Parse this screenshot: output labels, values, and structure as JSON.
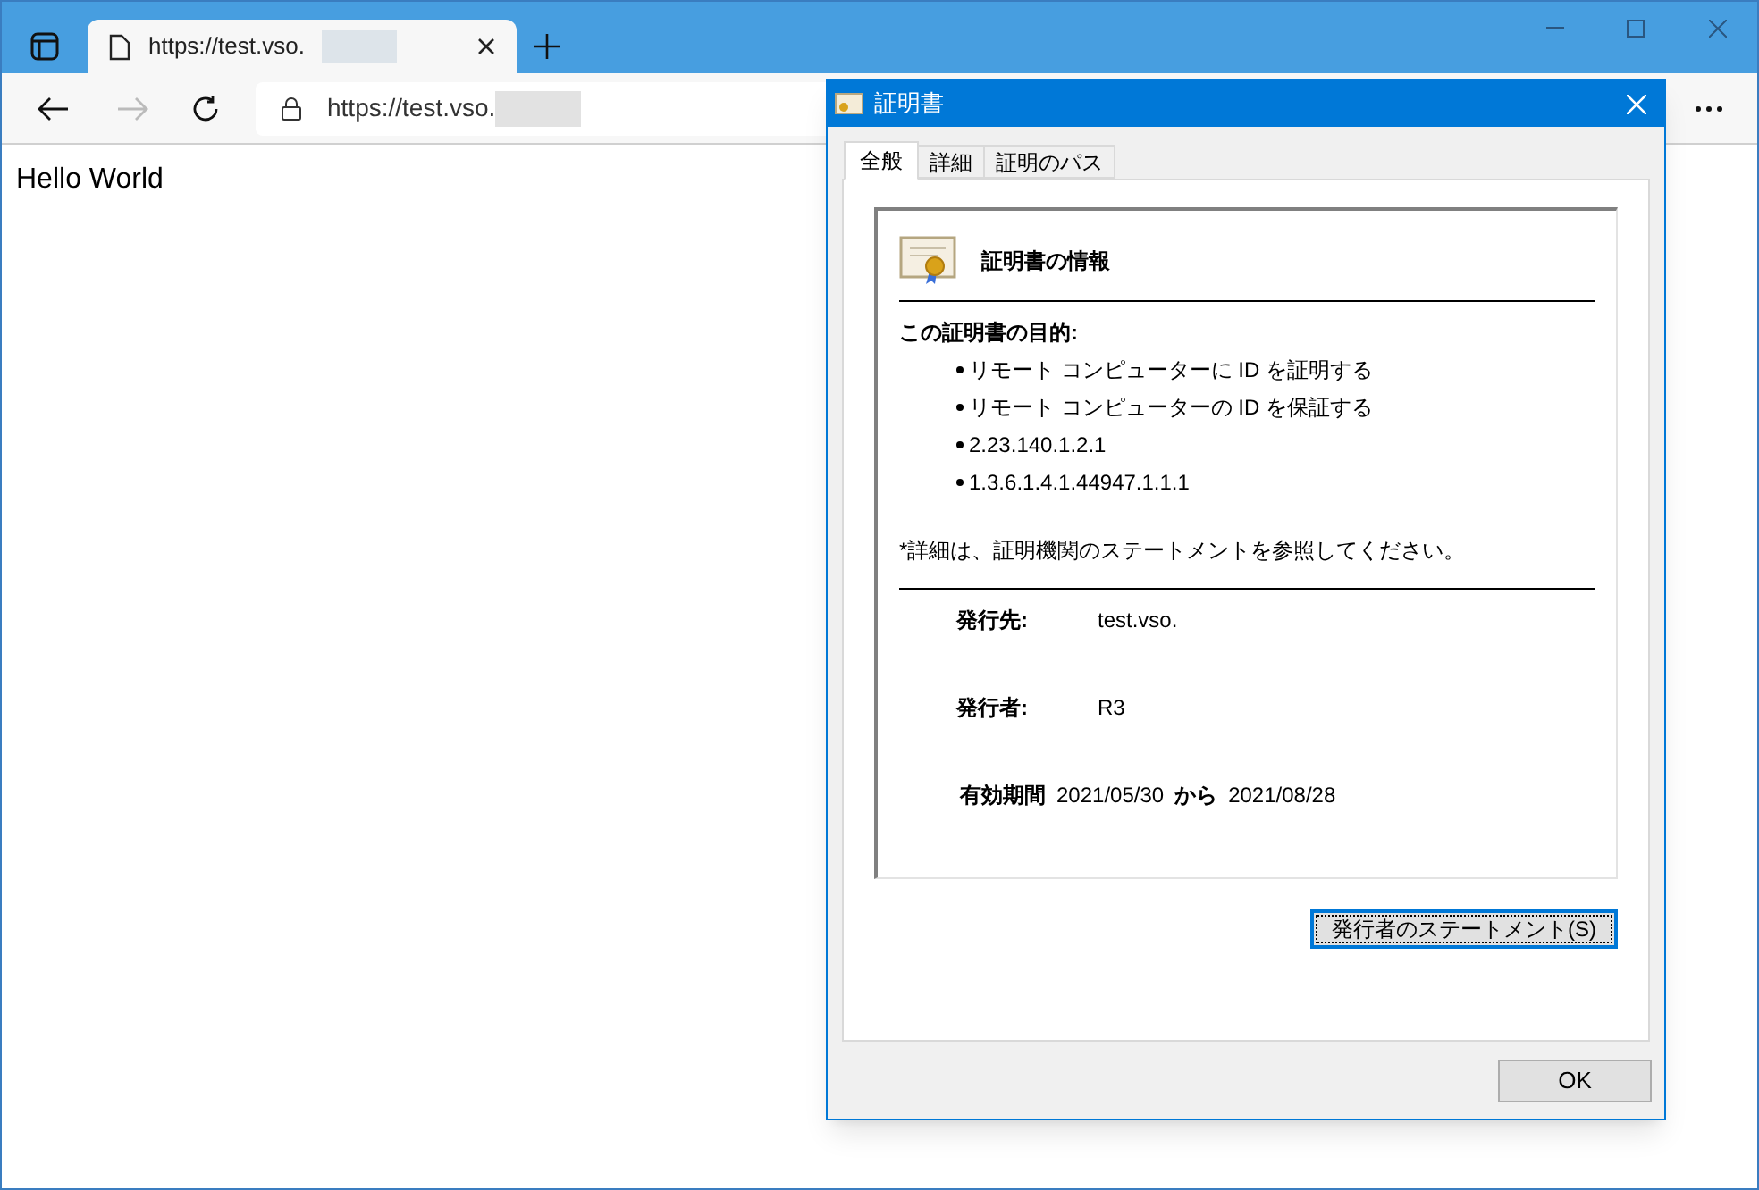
{
  "browser": {
    "tab_title": "https://test.vso.",
    "address": "https://test.vso.",
    "page_text": "Hello World"
  },
  "dialog": {
    "title": "証明書",
    "tabs": [
      {
        "label": "全般",
        "selected": true
      },
      {
        "label": "詳細",
        "selected": false
      },
      {
        "label": "証明のパス",
        "selected": false
      }
    ],
    "heading": "証明書の情報",
    "purpose_title": "この証明書の目的:",
    "purposes": [
      "リモート コンピューターに ID を証明する",
      "リモート コンピューターの ID を保証する",
      "2.23.140.1.2.1",
      "1.3.6.1.4.1.44947.1.1.1"
    ],
    "note": "*詳細は、証明機関のステートメントを参照してください。",
    "fields": [
      {
        "label": "発行先:",
        "value": "test.vso."
      },
      {
        "label": "発行者:",
        "value": "R3"
      }
    ],
    "validity": {
      "label": "有効期間",
      "from": "2021/05/30",
      "word": "から",
      "to": "2021/08/28"
    },
    "statement_button": "発行者のステートメント(S)",
    "ok_button": "OK"
  }
}
